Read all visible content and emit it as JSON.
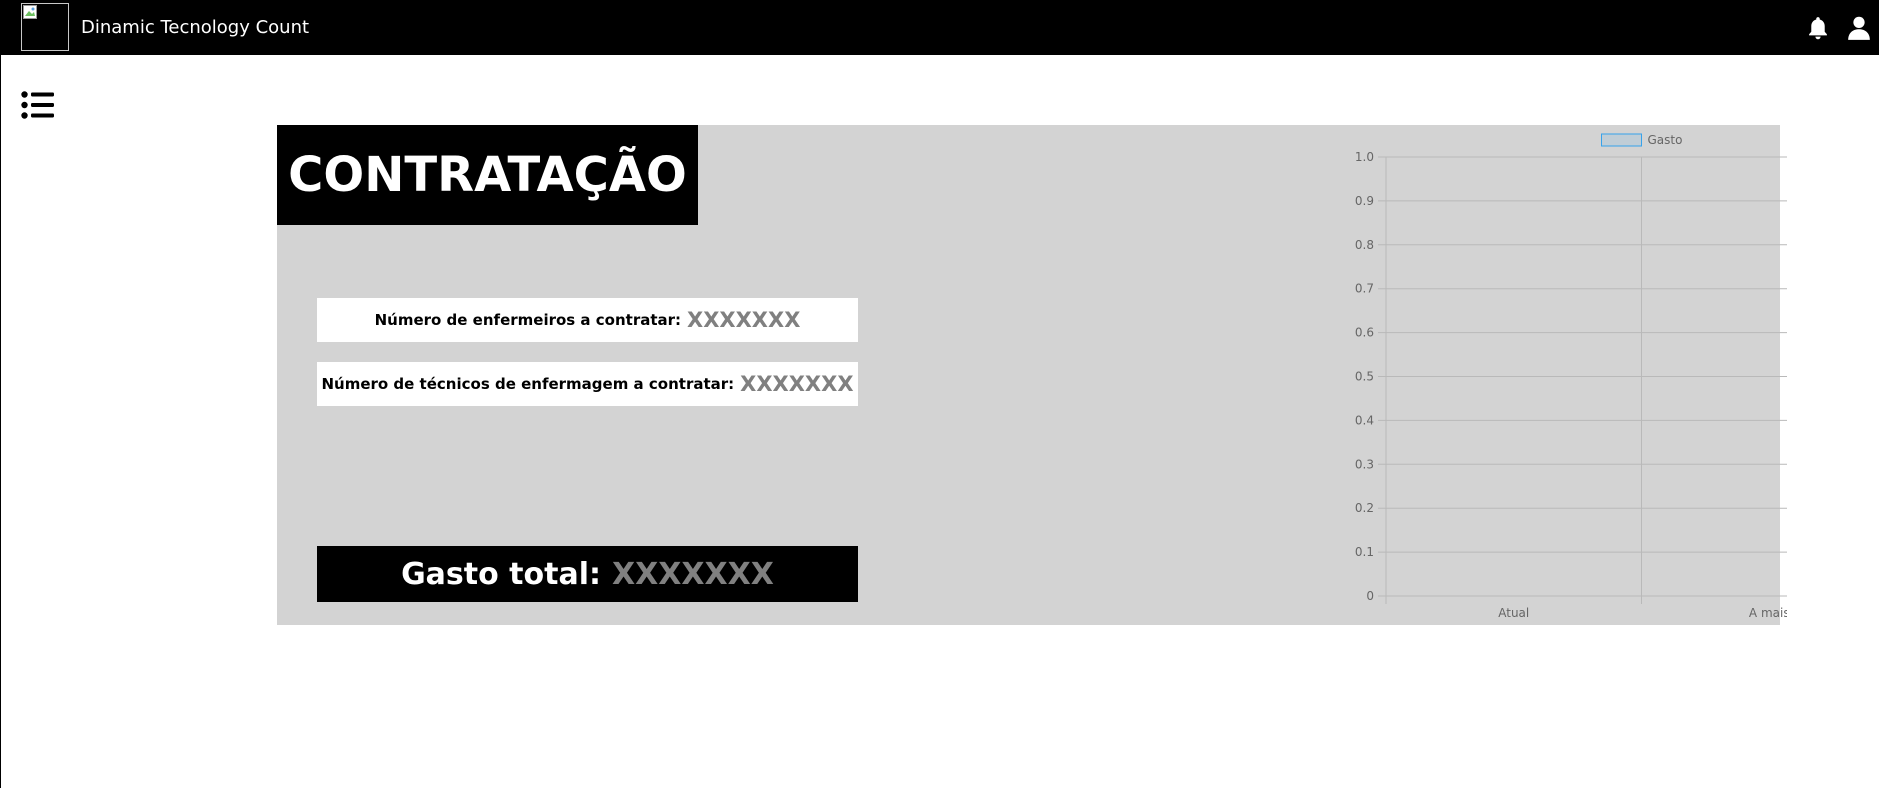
{
  "header": {
    "app_title": "Dinamic Tecnology Count",
    "icons": [
      "bell-icon",
      "user-icon"
    ]
  },
  "menu": {
    "icon": "list-icon"
  },
  "panel": {
    "title": "CONTRATAÇÃO",
    "nurses_label": "Número de enfermeiros a contratar:",
    "nurses_value": "XXXXXXX",
    "technicians_label": "Número de técnicos de enfermagem a contratar:",
    "technicians_value": "XXXXXXX",
    "total_label": "Gasto total:",
    "total_value": "XXXXXXX"
  },
  "colors": {
    "topbar": "#000000",
    "panel_bg": "#d3d3d3",
    "value_gray": "#808080",
    "legend_border": "#36a2eb"
  },
  "chart_data": {
    "type": "bar",
    "categories": [
      "Atual",
      "A mais"
    ],
    "series": [
      {
        "name": "Gasto",
        "values": []
      }
    ],
    "ylim": [
      0,
      1
    ],
    "yticks": [
      "1.0",
      "0.9",
      "0.8",
      "0.7",
      "0.6",
      "0.5",
      "0.4",
      "0.3",
      "0.2",
      "0.1",
      "0"
    ],
    "legend_position": "top",
    "grid": true
  }
}
